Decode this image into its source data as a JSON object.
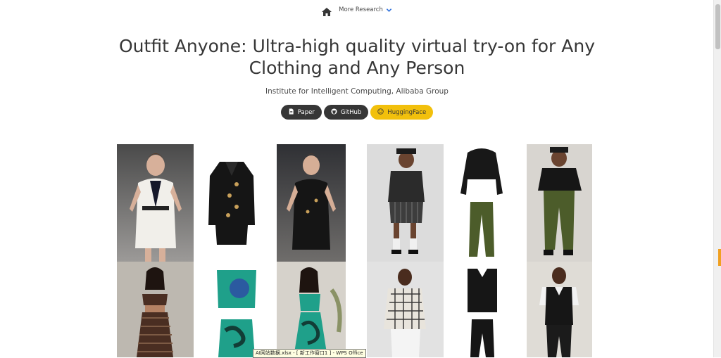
{
  "nav": {
    "home_icon": "home-icon",
    "more_research": "More Research",
    "chevron_icon": "chevron-down-icon"
  },
  "title_line1": "Outfit Anyone: Ultra-high quality virtual try-on for Any",
  "title_line2": "Clothing and Any Person",
  "affiliation": "Institute for Intelligent Computing, Alibaba Group",
  "links": [
    {
      "label": "Paper",
      "icon": "file-icon"
    },
    {
      "label": "GitHub",
      "icon": "github-icon"
    },
    {
      "label": "HuggingFace",
      "icon": "huggingface-icon"
    }
  ],
  "colors": {
    "accent_yellow": "#f2c00c",
    "dark_button": "#363636",
    "nav_chevron": "#3273dc"
  },
  "tooltip": "AI网站数据.xlsx - [ 新工作窗口1 ] - WPS Office"
}
